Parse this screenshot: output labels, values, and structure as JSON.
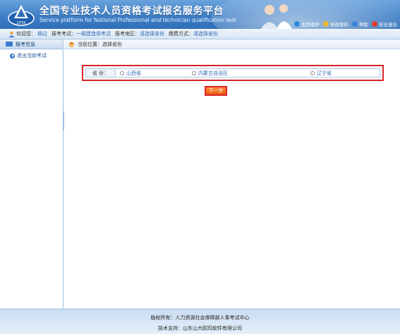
{
  "header": {
    "title": "全国专业技术人员资格考试报名服务平台",
    "subtitle": "Service platform for National Professional and technician qualification test",
    "links": [
      {
        "label": "主页维护",
        "icon": "globe-icon",
        "color": "#2a8be0"
      },
      {
        "label": "修改密码",
        "icon": "user-key-icon",
        "color": "#f2b531"
      },
      {
        "label": "帮助",
        "icon": "help-icon",
        "color": "#3b86d6"
      },
      {
        "label": "安全退出",
        "icon": "power-icon",
        "color": "#e23b2b"
      }
    ]
  },
  "infobar": {
    "welcome_label": "欢迎您：",
    "user": "杨过",
    "exam_label": "报考考试：",
    "exam": "一级建造师考试",
    "region_label": "报考地区：",
    "region": "请选择省份",
    "fee_label": "缴费方式：",
    "fee": "请选择省份"
  },
  "sidebar": {
    "heading": "报考信息",
    "item": "退出当前考试"
  },
  "main": {
    "breadcrumb": "当前位置：选择省份",
    "province_label": "省  份：",
    "options": [
      "山西省",
      "内蒙古自治区",
      "辽宁省"
    ],
    "next_button": "下一步"
  },
  "footer": {
    "copyright": "版权所有：人力资源社会保障部人事考试中心",
    "support": "技术支持：山东山大鸥玛软件有限公司"
  },
  "colors": {
    "accent": "#3f7fc6",
    "highlight": "#d8262a",
    "button": "#e85a0c"
  }
}
